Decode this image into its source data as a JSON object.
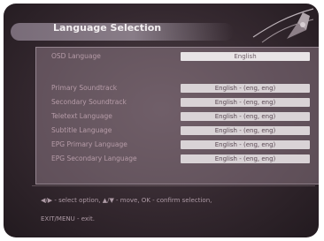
{
  "header": {
    "title": "Language Selection"
  },
  "settings": [
    {
      "label": "OSD Language",
      "value": "English"
    },
    {
      "label": "Primary Soundtrack",
      "value": "English - (eng, eng)"
    },
    {
      "label": "Secondary Soundtrack",
      "value": "English - (eng, eng)"
    },
    {
      "label": "Teletext Language",
      "value": "English - (eng, eng)"
    },
    {
      "label": "Subtitle Language",
      "value": "English - (eng, eng)"
    },
    {
      "label": "EPG Primary Language",
      "value": "English - (eng, eng)"
    },
    {
      "label": "EPG Secondary Language",
      "value": "English - (eng, eng)"
    }
  ],
  "help": {
    "line1": "◀/▶ - select option, ▲/▼ - move, OK - confirm selection,",
    "line2": "EXIT/MENU - exit."
  },
  "colors": {
    "background": "#2f2329",
    "panel": "#8f7c88",
    "field": "#d9d3d6",
    "label_text": "#b69ca8"
  }
}
